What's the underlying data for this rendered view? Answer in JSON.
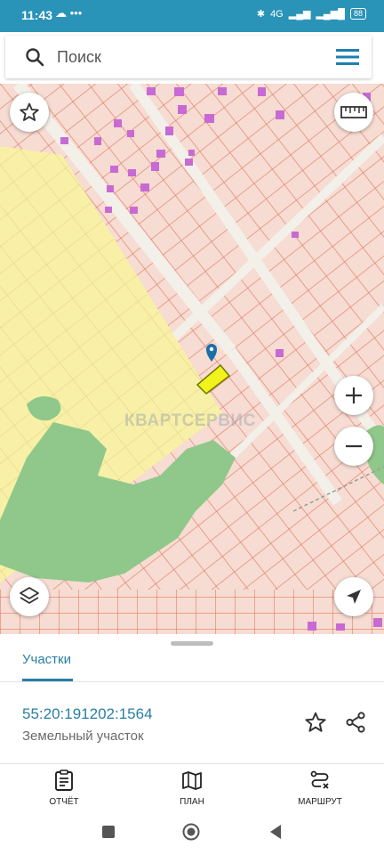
{
  "status_bar": {
    "time": "11:43",
    "notification_icons": "☁ •••",
    "network": "4G",
    "battery": "88"
  },
  "search": {
    "placeholder": "Поиск"
  },
  "map": {
    "watermark": "КВАРТСЕРВИС"
  },
  "bottom_sheet": {
    "tab_label": "Участки",
    "cadastral_number": "55:20:191202:1564",
    "parcel_type": "Земельный участок"
  },
  "bottom_nav": {
    "items": [
      {
        "label": "ОТЧЁТ",
        "icon": "clipboard-icon"
      },
      {
        "label": "ПЛАН",
        "icon": "map-icon"
      },
      {
        "label": "МАРШРУТ",
        "icon": "route-icon"
      }
    ]
  },
  "colors": {
    "accent": "#2a7fa3",
    "status_bar": "#2a93b8",
    "parcel_fill": "#f6dcd2",
    "parcel_line": "#e47a64",
    "forest": "#8fc88a",
    "zone_yellow": "#f7f0a6",
    "building": "#c86ad4",
    "selected_parcel": "#f2f21c"
  }
}
